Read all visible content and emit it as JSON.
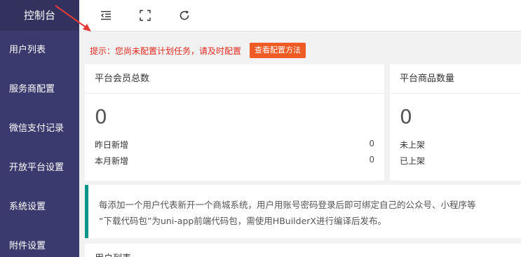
{
  "sidebar": {
    "brand": "控制台",
    "items": [
      {
        "label": "用户列表"
      },
      {
        "label": "服务商配置"
      },
      {
        "label": "微信支付记录"
      },
      {
        "label": "开放平台设置"
      },
      {
        "label": "系统设置"
      },
      {
        "label": "附件设置"
      }
    ]
  },
  "topbar": {
    "icons": [
      "menu-fold-icon",
      "fullscreen-icon",
      "refresh-icon"
    ]
  },
  "notice": {
    "text": "提示：您尚未配置计划任务，请及时配置",
    "button": "查看配置方法",
    "text_color": "#e0291f",
    "button_color": "#f05a24"
  },
  "cards": [
    {
      "title": "平台会员总数",
      "value": "0",
      "rows": [
        {
          "label": "昨日新增",
          "value": "0"
        },
        {
          "label": "本月新增",
          "value": "0"
        }
      ]
    },
    {
      "title": "平台商品数量",
      "value": "0",
      "rows": [
        {
          "label": "未上架",
          "value": ""
        },
        {
          "label": "已上架",
          "value": ""
        }
      ]
    }
  ],
  "info": {
    "line1": "每添加一个用户代表新开一个商城系统，用户用账号密码登录后即可绑定自己的公众号、小程序等",
    "line2": "“下载代码包”为uni-app前端代码包，需使用HBuilderX进行编译后发布。",
    "accent": "#009688"
  },
  "bottom": {
    "title": "用户列表"
  },
  "colors": {
    "sidebar_bg": "#3b3a6e",
    "brand_bg": "#33325f"
  }
}
